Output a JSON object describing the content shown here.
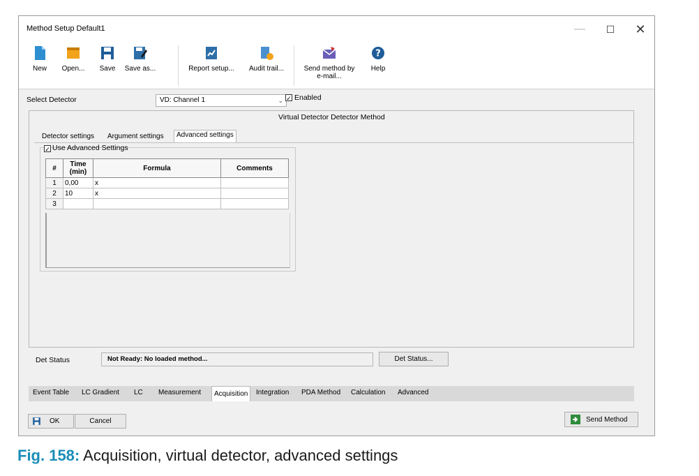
{
  "window": {
    "title": "Method Setup Default1"
  },
  "window_controls": {
    "minimize": "—",
    "maximize": "☐",
    "close": "✕"
  },
  "toolbar": {
    "items": [
      {
        "label": "New",
        "icon": "new-file-icon"
      },
      {
        "label": "Open...",
        "icon": "folder-icon"
      },
      {
        "label": "Save",
        "icon": "save-icon"
      },
      {
        "label": "Save as...",
        "icon": "save-as-icon"
      },
      {
        "label": "Report setup...",
        "icon": "report-icon"
      },
      {
        "label": "Audit trail...",
        "icon": "audit-trail-icon"
      },
      {
        "label": "Send method by e-mail...",
        "icon": "email-icon"
      },
      {
        "label": "Help",
        "icon": "help-icon"
      }
    ]
  },
  "detector": {
    "select_label": "Select Detector",
    "selected": "VD: Channel 1",
    "enabled_label": "Enabled",
    "enabled_checked": true
  },
  "panel": {
    "heading": "Virtual Detector Detector Method",
    "tabs": [
      "Detector settings",
      "Argument settings",
      "Advanced settings"
    ],
    "active_tab": "Advanced settings",
    "use_advanced_label": "Use Advanced Settings",
    "use_advanced_checked": true
  },
  "grid": {
    "headers": {
      "num": "#",
      "time": "Time",
      "time_unit": "(min)",
      "formula": "Formula",
      "comments": "Comments"
    },
    "rows": [
      {
        "num": "1",
        "time": "0,00",
        "formula": "x",
        "comments": ""
      },
      {
        "num": "2",
        "time": "10",
        "formula": "x",
        "comments": ""
      },
      {
        "num": "3",
        "time": "",
        "formula": "",
        "comments": ""
      }
    ]
  },
  "status": {
    "label": "Det Status",
    "value": "Not Ready: No loaded method...",
    "button": "Det Status..."
  },
  "bottom_tabs": {
    "items": [
      "Event Table",
      "LC Gradient",
      "LC",
      "Measurement",
      "Acquisition",
      "Integration",
      "PDA Method",
      "Calculation",
      "Advanced"
    ],
    "active": "Acquisition"
  },
  "footer": {
    "ok": "OK",
    "cancel": "Cancel",
    "send": "Send Method"
  },
  "caption": {
    "figure": "Fig. 158:",
    "text": "Acquisition, virtual detector, advanced settings"
  },
  "colors": {
    "caption_accent": "#1b8db8",
    "icon_blue": "#2d6fa8",
    "icon_orange": "#f2a31b"
  }
}
